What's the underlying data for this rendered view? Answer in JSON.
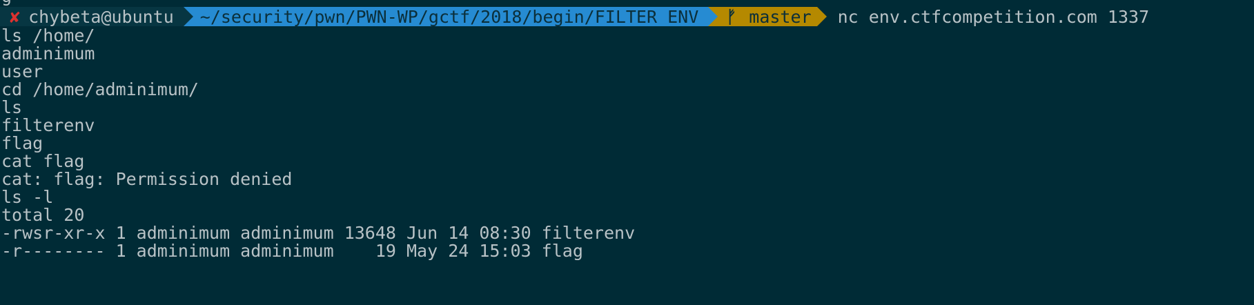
{
  "prompt": {
    "status_icon": "✘",
    "user_host": "chybeta@ubuntu",
    "directory": "~/security/pwn/PWN-WP/gctf/2018/begin/FILTER ENV",
    "branch_icon": "ᚠ",
    "branch": "master",
    "command": "nc env.ctfcompetition.com 1337"
  },
  "top_fragment": "g",
  "output_lines": [
    "ls /home/",
    "adminimum",
    "user",
    "cd /home/adminimum/",
    "ls",
    "filterenv",
    "flag",
    "cat flag",
    "cat: flag: Permission denied",
    "ls -l",
    "total 20",
    "-rwsr-xr-x 1 adminimum adminimum 13648 Jun 14 08:30 filterenv",
    "-r-------- 1 adminimum adminimum    19 May 24 15:03 flag"
  ],
  "colors": {
    "background": "#002b36",
    "status_segment": "#073642",
    "directory_segment": "#268bd2",
    "git_segment": "#b58900",
    "error_icon": "#dc322f",
    "text": "#b8c2c6"
  }
}
